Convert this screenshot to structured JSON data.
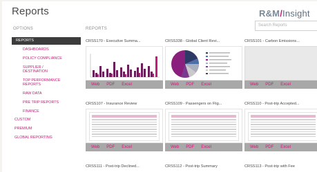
{
  "page": {
    "title": "Reports"
  },
  "logo": {
    "part1": "R&M",
    "slash": "/",
    "part2": "Insight"
  },
  "search": {
    "placeholder": "Search Reports"
  },
  "sidebar": {
    "heading": "OPTIONS",
    "items": [
      {
        "label": "REPORTS",
        "active": true
      },
      {
        "label": "DASHBOARDS"
      },
      {
        "label": "POLICY COMPLIANCE"
      },
      {
        "label": "SUPPLIER / DESTINATION"
      },
      {
        "label": "TOP PERFORMANCE REPORTS"
      },
      {
        "label": "RAW DATA"
      },
      {
        "label": "PRE TRIP REPORTS"
      },
      {
        "label": "FINANCE"
      },
      {
        "label": "CUSTOM"
      },
      {
        "label": "PREMIUM"
      },
      {
        "label": "GLOBAL REPORTING"
      }
    ]
  },
  "main": {
    "heading": "REPORTS",
    "link_labels": {
      "web": "Web",
      "pdf": "PDF",
      "excel": "Excel"
    },
    "cards": [
      {
        "title": "CRSS170 - Executive Summa..."
      },
      {
        "title": "CRSS338 - Global Client Revi..."
      },
      {
        "title": "CRSS101 - Carbon Emissions..."
      },
      {
        "title": "CRSS107 - Insurance Review"
      },
      {
        "title": "CRSS109 - Passengers on Flig..."
      },
      {
        "title": "CRSS110 - Post-trip Accepted..."
      },
      {
        "title": "CRSS111 - Post-trip Declined..."
      },
      {
        "title": "CRSS112 - Post-trip Summary"
      },
      {
        "title": "CRSS113 - Post-trip with Fee"
      }
    ]
  }
}
